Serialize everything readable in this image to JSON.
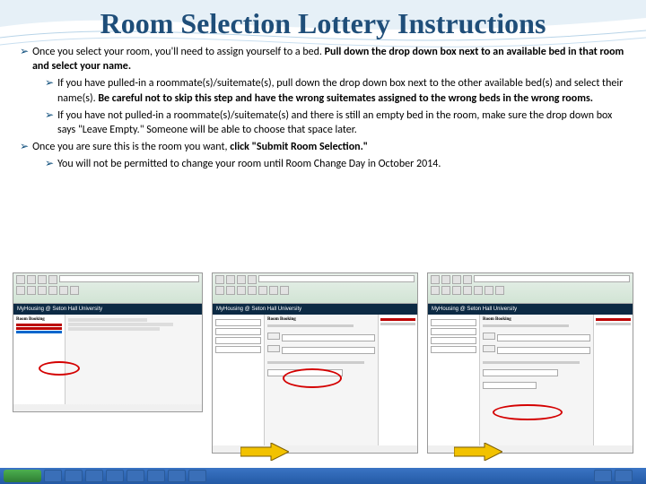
{
  "title": "Room Selection Lottery Instructions",
  "bullets": {
    "lvl1a_pre": "Once you select your room, you'll need to assign yourself to a bed. ",
    "lvl1a_bold": "Pull down the drop down box next to an available bed in that room and select your name.",
    "lvl2a_pre": "If you have pulled-in a roommate(s)/suitemate(s), pull down the drop down box next to the other available bed(s) and select their name(s). ",
    "lvl2a_bold": "Be careful not to skip this step and have the wrong suitemates assigned to the wrong beds in the wrong rooms.",
    "lvl2b": "If you have not pulled-in a roommate(s)/suitemate(s) and there is still an empty bed in the room, make sure the drop down box says \"Leave Empty.\" Someone will be able to choose that space later.",
    "lvl1b_pre": "Once you are sure this is the room you want, ",
    "lvl1b_bold": "click \"Submit Room Selection.\"",
    "lvl2c": "You will not be permitted to change your room until Room Change Day in October 2014."
  },
  "screenshots": {
    "banner": "MyHousing @ Seton Hall University",
    "section": "Room Booking"
  },
  "taskbar": {
    "clock": ""
  }
}
